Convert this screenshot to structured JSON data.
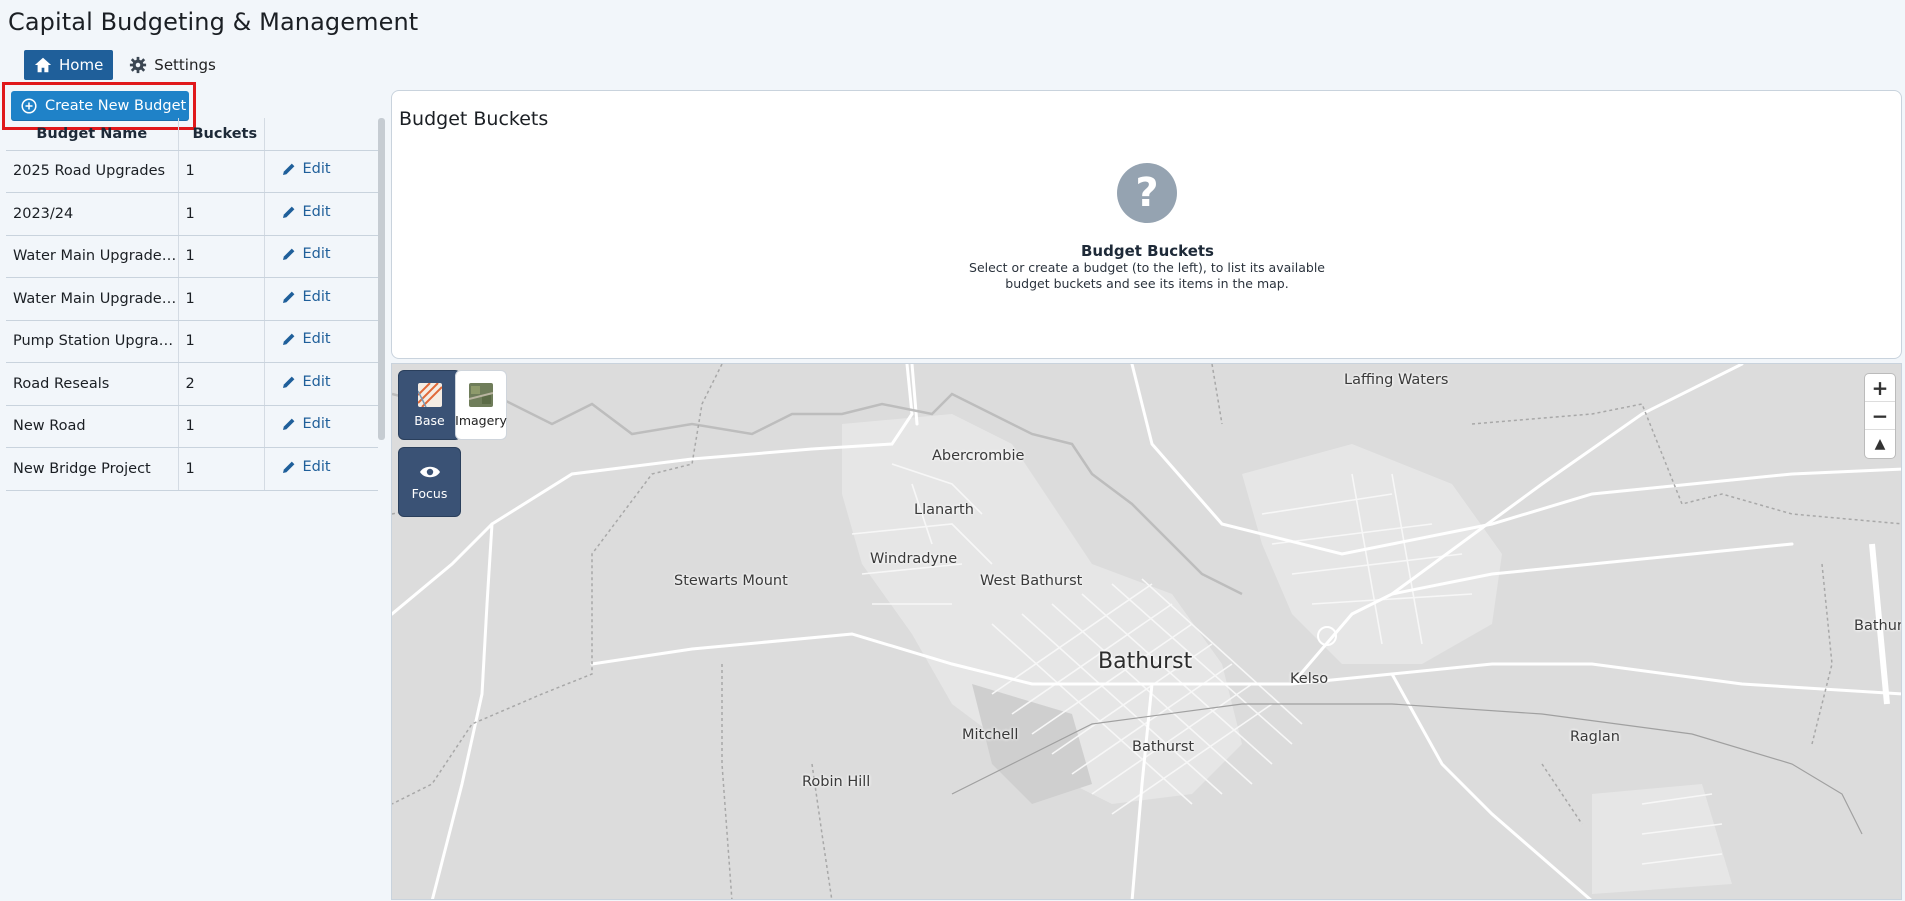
{
  "app": {
    "title": "Capital Budgeting & Management"
  },
  "nav": {
    "tabs": [
      {
        "label": "Home",
        "icon": "home-icon",
        "active": true
      },
      {
        "label": "Settings",
        "icon": "gear-icon",
        "active": false
      }
    ]
  },
  "create_button": {
    "label": "Create New Budget",
    "icon": "plus-circle-icon"
  },
  "budget_table": {
    "columns": [
      "Budget Name",
      "Buckets",
      ""
    ],
    "rows": [
      {
        "name": "2025 Road Upgrades",
        "buckets": "1",
        "action": "Edit"
      },
      {
        "name": "2023/24",
        "buckets": "1",
        "action": "Edit"
      },
      {
        "name": "Water Main Upgrade…",
        "buckets": "1",
        "action": "Edit"
      },
      {
        "name": "Water Main Upgrade…",
        "buckets": "1",
        "action": "Edit"
      },
      {
        "name": "Pump Station Upgra…",
        "buckets": "1",
        "action": "Edit"
      },
      {
        "name": "Road Reseals",
        "buckets": "2",
        "action": "Edit"
      },
      {
        "name": "New Road",
        "buckets": "1",
        "action": "Edit"
      },
      {
        "name": "New Bridge Project",
        "buckets": "1",
        "action": "Edit"
      }
    ]
  },
  "buckets_panel": {
    "title": "Budget Buckets",
    "empty_icon": "question-icon",
    "empty_title": "Budget Buckets",
    "empty_text": "Select or create a budget (to the left), to list its available budget buckets and see its items in the map."
  },
  "map": {
    "layer_buttons": [
      {
        "label": "Base",
        "icon": "map-base-icon"
      },
      {
        "label": "Imagery",
        "icon": "imagery-icon"
      },
      {
        "label": "Focus",
        "icon": "eye-icon"
      }
    ],
    "zoom": {
      "in": "+",
      "out": "−",
      "north": "▲"
    },
    "places": [
      "Laffing Waters",
      "Abercrombie",
      "Llanarth",
      "Windradyne",
      "West Bathurst",
      "Stewarts Mount",
      "Bathurst",
      "Kelso",
      "Mitchell",
      "Bathurst",
      "Robin Hill",
      "Raglan",
      "Bathurst"
    ]
  }
}
